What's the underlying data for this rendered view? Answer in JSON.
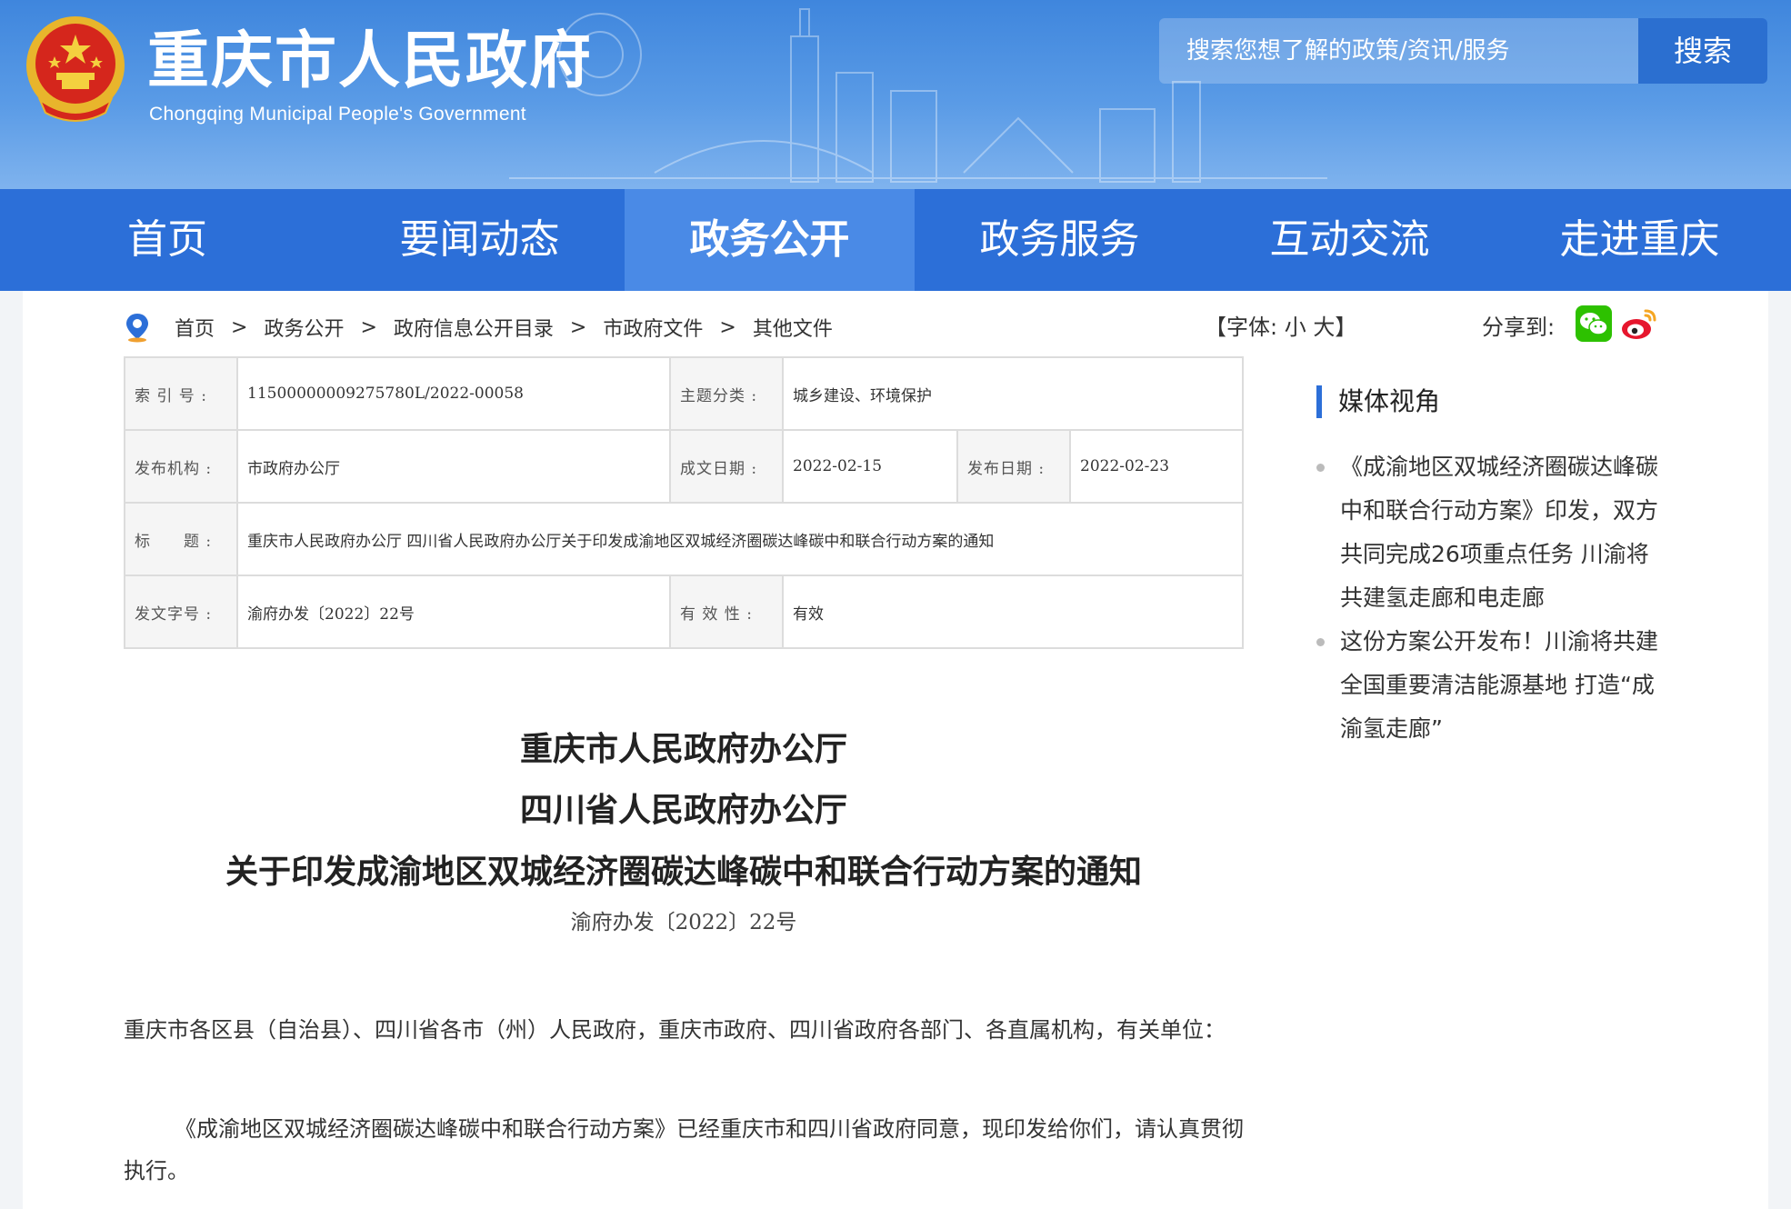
{
  "header": {
    "title": "重庆市人民政府",
    "subtitle": "Chongqing Municipal People's Government",
    "search_placeholder": "搜索您想了解的政策/资讯/服务",
    "search_button": "搜索"
  },
  "nav": [
    "首页",
    "要闻动态",
    "政务公开",
    "政务服务",
    "互动交流",
    "走进重庆"
  ],
  "breadcrumb": [
    "首页",
    "政务公开",
    "政府信息公开目录",
    "市政府文件",
    "其他文件"
  ],
  "breadcrumb_sep": ">",
  "font_size": {
    "open": "【字体:",
    "small": "小",
    "large": "大",
    "close": "】"
  },
  "share_label": "分享到:",
  "meta": {
    "index_label": "索 引 号 :",
    "index_value": "11500000009275780L/2022-00058",
    "category_label": "主题分类 :",
    "category_value": "城乡建设、环境保护",
    "publisher_label": "发布机构 :",
    "publisher_value": "市政府办公厅",
    "created_label": "成文日期 :",
    "created_value": "2022-02-15",
    "published_label": "发布日期 :",
    "published_value": "2022-02-23",
    "title_label": "标　　题 :",
    "title_value": "重庆市人民政府办公厅 四川省人民政府办公厅关于印发成渝地区双城经济圈碳达峰碳中和联合行动方案的通知",
    "docnum_label": "发文字号 :",
    "docnum_value": "渝府办发〔2022〕22号",
    "validity_label": "有 效 性 :",
    "validity_value": "有效"
  },
  "article": {
    "title_line1": "重庆市人民政府办公厅",
    "title_line2": "四川省人民政府办公厅",
    "title_line3": "关于印发成渝地区双城经济圈碳达峰碳中和联合行动方案的通知",
    "doc_number": "渝府办发〔2022〕22号",
    "para1": "重庆市各区县（自治县）、四川省各市（州）人民政府，重庆市政府、四川省政府各部门、各直属机构，有关单位：",
    "para2": "《成渝地区双城经济圈碳达峰碳中和联合行动方案》已经重庆市和四川省政府同意，现印发给你们，请认真贯彻执行。"
  },
  "sidebar": {
    "title": "媒体视角",
    "items": [
      "《成渝地区双城经济圈碳达峰碳中和联合行动方案》印发，双方共同完成26项重点任务 川渝将共建氢走廊和电走廊",
      "这份方案公开发布！川渝将共建全国重要清洁能源基地 打造“成渝氢走廊”"
    ]
  },
  "colors": {
    "header_blue": "#3f86dd",
    "nav_blue": "#2c6fd8",
    "nav_active": "#4a8ae6",
    "page_bg": "#f2f4f7"
  }
}
